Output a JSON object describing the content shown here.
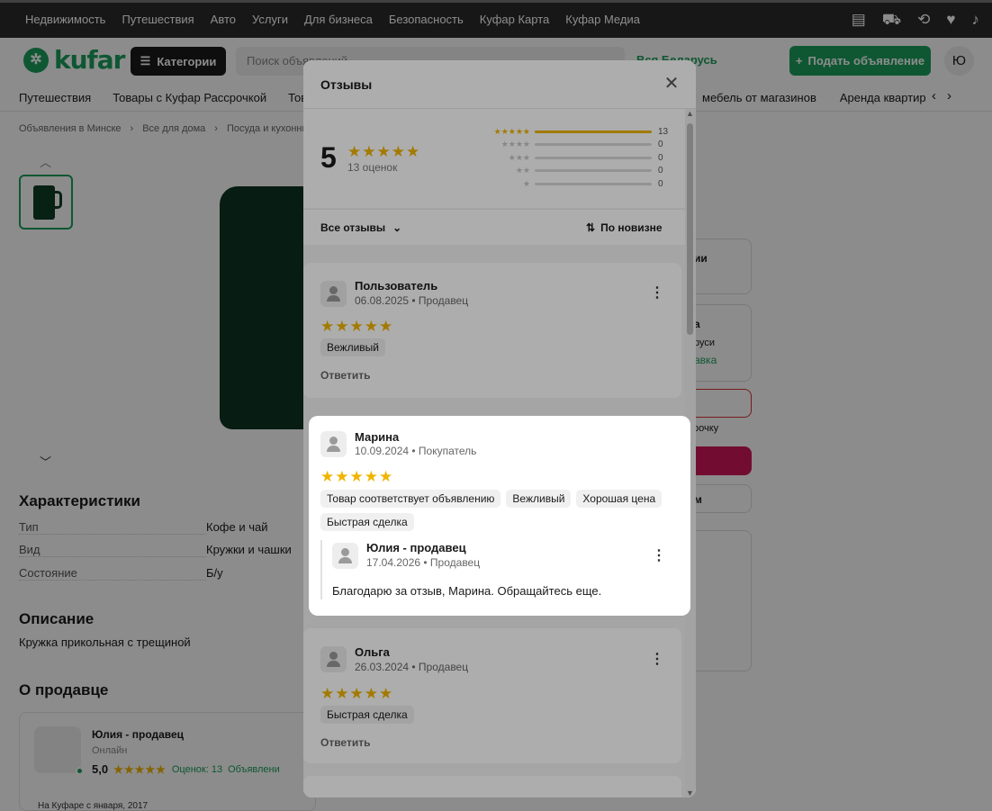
{
  "topbar": {
    "links": [
      "Недвижимость",
      "Путешествия",
      "Авто",
      "Услуги",
      "Для бизнеса",
      "Безопасность",
      "Куфар Карта",
      "Куфар Медиа"
    ]
  },
  "header": {
    "logo": "kufar",
    "categories": "Категории",
    "search_placeholder": "Поиск объявлений",
    "region": "Вся Беларусь",
    "post_ad": "Подать объявление",
    "user_initial": "Ю"
  },
  "subnav": {
    "left": [
      "Путешествия",
      "Товары с Куфар Рассрочкой",
      "Товар"
    ],
    "right": [
      "мебель от магазинов",
      "Аренда квартир"
    ]
  },
  "breadcrumbs": [
    "Объявления в Минске",
    "Все для дома",
    "Посуда и кухонные ви"
  ],
  "characteristics": {
    "title": "Характеристики",
    "rows": [
      {
        "k": "Тип",
        "v": "Кофе и чай"
      },
      {
        "k": "Вид",
        "v": "Кружки и чашки"
      },
      {
        "k": "Состояние",
        "v": "Б/у"
      }
    ]
  },
  "description": {
    "title": "Описание",
    "text": "Кружка прикольная с трещиной"
  },
  "seller": {
    "title": "О продавце",
    "name": "Юлия - продавец",
    "status": "Онлайн",
    "rating": "5,0",
    "reviews_link": "Оценок: 13",
    "ads_link": "Объявлени",
    "since": "На Куфаре с января, 2017"
  },
  "side": {
    "t1": "ии",
    "t2": "а",
    "t3": "руси",
    "t4": "авка",
    "t5": "рочку",
    "t6": "м"
  },
  "modal": {
    "title": "Отзывы",
    "rating": "5",
    "rating_count": "13 оценок",
    "distribution": [
      {
        "stars": 5,
        "count": 13,
        "fraction": 1.0
      },
      {
        "stars": 4,
        "count": 0,
        "fraction": 0
      },
      {
        "stars": 3,
        "count": 0,
        "fraction": 0
      },
      {
        "stars": 2,
        "count": 0,
        "fraction": 0
      },
      {
        "stars": 1,
        "count": 0,
        "fraction": 0
      }
    ],
    "filter_label": "Все отзывы",
    "sort_label": "По новизне",
    "reviews": [
      {
        "name": "Пользователь",
        "meta": "06.08.2025 • Продавец",
        "stars": "★★★★★",
        "tags": [
          "Вежливый"
        ],
        "reply": "Ответить"
      },
      {
        "name": "Марина",
        "meta": "10.09.2024 • Покупатель",
        "stars": "★★★★★",
        "tags": [
          "Товар соответствует объявлению",
          "Вежливый",
          "Хорошая цена",
          "Быстрая сделка"
        ],
        "answer": {
          "name": "Юлия - продавец",
          "meta": "17.04.2026 • Продавец",
          "text": "Благодарю за отзыв, Марина. Обращайтесь еще."
        }
      },
      {
        "name": "Ольга",
        "meta": "26.03.2024 • Продавец",
        "stars": "★★★★★",
        "tags": [
          "Быстрая сделка"
        ],
        "reply": "Ответить"
      }
    ]
  },
  "colors": {
    "brand": "#1a9e5c",
    "star": "#f0b400",
    "overlay": "rgba(0,0,0,0.45)"
  }
}
